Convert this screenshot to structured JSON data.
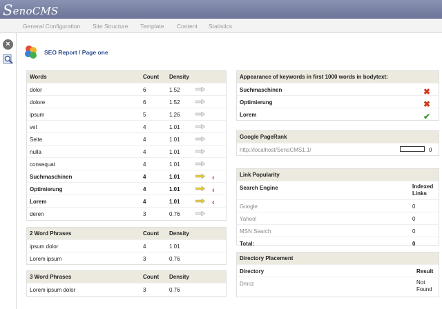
{
  "app": {
    "logo": "SenoCMS"
  },
  "nav": [
    "General Configuration",
    "Site Structure",
    "Template",
    "Content",
    "Statistics"
  ],
  "page": {
    "title": "SEO Report / Page one"
  },
  "words": {
    "headers": [
      "Words",
      "Count",
      "Density"
    ],
    "rows": [
      {
        "word": "dolor",
        "count": "6",
        "density": "1.52",
        "bold": false,
        "flag": false
      },
      {
        "word": "dolore",
        "count": "6",
        "density": "1.52",
        "bold": false,
        "flag": false
      },
      {
        "word": "ipsum",
        "count": "5",
        "density": "1.26",
        "bold": false,
        "flag": false
      },
      {
        "word": "vel",
        "count": "4",
        "density": "1.01",
        "bold": false,
        "flag": false
      },
      {
        "word": "Seite",
        "count": "4",
        "density": "1.01",
        "bold": false,
        "flag": false
      },
      {
        "word": "nulla",
        "count": "4",
        "density": "1.01",
        "bold": false,
        "flag": false
      },
      {
        "word": "consequat",
        "count": "4",
        "density": "1.01",
        "bold": false,
        "flag": false
      },
      {
        "word": "Suchmaschinen",
        "count": "4",
        "density": "1.01",
        "bold": true,
        "flag": true
      },
      {
        "word": "Optimierung",
        "count": "4",
        "density": "1.01",
        "bold": true,
        "flag": true
      },
      {
        "word": "Lorem",
        "count": "4",
        "density": "1.01",
        "bold": true,
        "flag": true
      },
      {
        "word": "deren",
        "count": "3",
        "density": "0.76",
        "bold": false,
        "flag": false
      }
    ]
  },
  "phrases2": {
    "headers": [
      "2 Word Phrases",
      "Count",
      "Density"
    ],
    "rows": [
      {
        "word": "ipsum dolor",
        "count": "4",
        "density": "1.01"
      },
      {
        "word": "Lorem ipsum",
        "count": "3",
        "density": "0.76"
      }
    ]
  },
  "phrases3": {
    "headers": [
      "3 Word Phrases",
      "Count",
      "Density"
    ],
    "rows": [
      {
        "word": "Lorem ipsum dolor",
        "count": "3",
        "density": "0.76"
      }
    ]
  },
  "appearance": {
    "header": "Appearance of keywords in first 1000 words in bodytext:",
    "rows": [
      {
        "keyword": "Suchmaschinen",
        "found": false
      },
      {
        "keyword": "Optimierung",
        "found": false
      },
      {
        "keyword": "Lorem",
        "found": true
      }
    ]
  },
  "pagerank": {
    "header": "Google PageRank",
    "url": "http://localhost/SenoCMS1.1/",
    "value": "0"
  },
  "links": {
    "header": "Link Popularity",
    "col1": "Search Engine",
    "col2": "Indexed Links",
    "rows": [
      {
        "engine": "Google",
        "value": "0"
      },
      {
        "engine": "Yahoo!",
        "value": "0"
      },
      {
        "engine": "MSN Search",
        "value": "0"
      }
    ],
    "total_label": "Total:",
    "total_value": "0"
  },
  "directory": {
    "header": "Directory Placement",
    "col1": "Directory",
    "col2": "Result",
    "rows": [
      {
        "name": "Dmoz",
        "result": "Not Found"
      }
    ]
  },
  "colors": {
    "topbar": "#7a83a6",
    "panel_head": "#ece9df",
    "link_gray": "#8a8a8a",
    "fail": "#d0391f",
    "ok": "#3aa02a"
  }
}
